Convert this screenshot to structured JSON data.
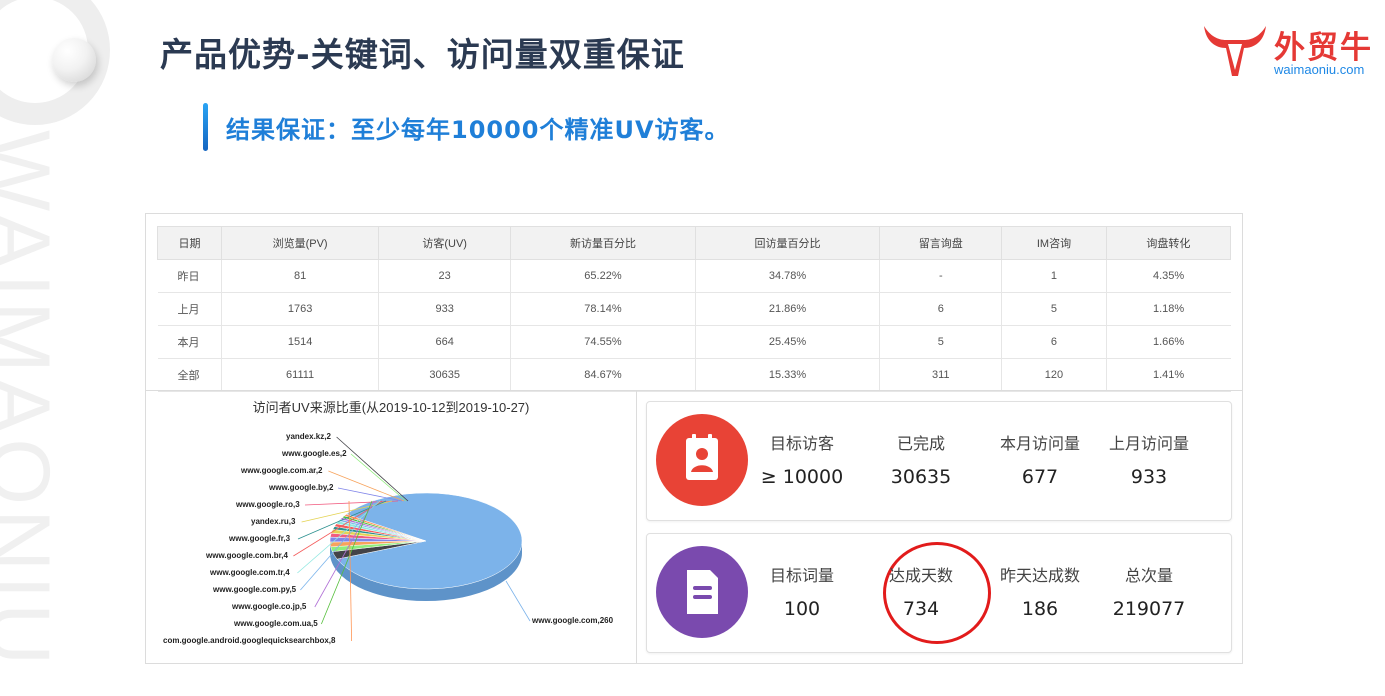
{
  "watermark": {
    "text": "WAIMAONIU"
  },
  "title": "产品优势-关键词、访问量双重保证",
  "subtitle": "结果保证：至少每年10000个精准UV访客。",
  "logo": {
    "brand": "外贸牛",
    "domain": "waimaoniu.com"
  },
  "colors": {
    "accent_blue": "#1f7fd8",
    "title": "#2b3a52",
    "logo_red": "#e53935",
    "kpi_red": "#e84336",
    "kpi_purple": "#7a4aae",
    "pie_main": "#7cb3ea"
  },
  "stats_table": {
    "headers": [
      "日期",
      "浏览量(PV)",
      "访客(UV)",
      "新访量百分比",
      "回访量百分比",
      "留言询盘",
      "IM咨询",
      "询盘转化"
    ],
    "rows": [
      [
        "昨日",
        "81",
        "23",
        "65.22%",
        "34.78%",
        "-",
        "1",
        "4.35%"
      ],
      [
        "上月",
        "1763",
        "933",
        "78.14%",
        "21.86%",
        "6",
        "5",
        "1.18%"
      ],
      [
        "本月",
        "1514",
        "664",
        "74.55%",
        "25.45%",
        "5",
        "6",
        "1.66%"
      ],
      [
        "全部",
        "61111",
        "30635",
        "84.67%",
        "15.33%",
        "311",
        "120",
        "1.41%"
      ]
    ]
  },
  "pie": {
    "title": "访问者UV来源比重(从2019-10-12到2019-10-27)",
    "labels": [
      "yandex.kz,2",
      "www.google.es,2",
      "www.google.com.ar,2",
      "www.google.by,2",
      "www.google.ro,3",
      "yandex.ru,3",
      "www.google.fr,3",
      "www.google.com.br,4",
      "www.google.com.tr,4",
      "www.google.com.py,5",
      "www.google.co.jp,5",
      "www.google.com.ua,5",
      "com.google.android.googlequicksearchbox,8",
      "www.google.com,260"
    ]
  },
  "chart_data": {
    "type": "pie",
    "title": "访问者UV来源比重(从2019-10-12到2019-10-27)",
    "slices": [
      {
        "label": "www.google.com",
        "value": 260
      },
      {
        "label": "com.google.android.googlequicksearchbox",
        "value": 8
      },
      {
        "label": "www.google.com.ua",
        "value": 5
      },
      {
        "label": "www.google.co.jp",
        "value": 5
      },
      {
        "label": "www.google.com.py",
        "value": 5
      },
      {
        "label": "www.google.com.tr",
        "value": 4
      },
      {
        "label": "www.google.com.br",
        "value": 4
      },
      {
        "label": "www.google.fr",
        "value": 3
      },
      {
        "label": "yandex.ru",
        "value": 3
      },
      {
        "label": "www.google.ro",
        "value": 3
      },
      {
        "label": "www.google.by",
        "value": 2
      },
      {
        "label": "www.google.com.ar",
        "value": 2
      },
      {
        "label": "www.google.es",
        "value": 2
      },
      {
        "label": "yandex.kz",
        "value": 2
      }
    ]
  },
  "kpi_visitors": {
    "icon": "badge-user-icon",
    "items": [
      {
        "label": "目标访客",
        "value": "≥ 10000"
      },
      {
        "label": "已完成",
        "value": "30635"
      },
      {
        "label": "本月访问量",
        "value": "677"
      },
      {
        "label": "上月访问量",
        "value": "933"
      }
    ]
  },
  "kpi_keywords": {
    "icon": "document-icon",
    "items": [
      {
        "label": "目标词量",
        "value": "100"
      },
      {
        "label": "达成天数",
        "value": "734"
      },
      {
        "label": "昨天达成数",
        "value": "186"
      },
      {
        "label": "总次量",
        "value": "219077"
      }
    ]
  }
}
